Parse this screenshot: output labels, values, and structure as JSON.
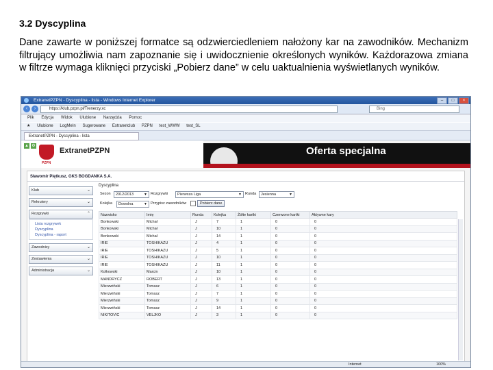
{
  "document": {
    "heading": "3.2 Dyscyplina",
    "paragraph": "Dane zawarte w poniższej formatce są odzwierciedleniem nałożony kar na zawodników. Mechanizm filtrujący umożliwia nam zapoznanie się i uwidocznienie określonych wyników. Każdorazowa zmiana w filtrze wymaga kliknięci przyciski „Pobierz dane” w celu uaktualnienia wyświetlanych wyników."
  },
  "browser": {
    "window_title": "ExtranetPZPN - Dyscyplina - lista - Windows Internet Explorer",
    "address": "https://klub.pzpn.pl/Trenerzy.xc",
    "search_placeholder": "Bing",
    "menu": [
      "Plik",
      "Edycja",
      "Widok",
      "Ulubione",
      "Narzędzia",
      "Pomoc"
    ],
    "favorites": [
      "Ulubione",
      "LogMeIn",
      "Sugerowane",
      "Extranetclub",
      "PZPN",
      "test_WWW",
      "test_SL"
    ],
    "tab": "ExtranetPZPN - Dyscyplina - lista",
    "status_zone": "Internet",
    "zoom": "100%"
  },
  "site": {
    "logo_text": "ExtranetPZPN",
    "logo_sub": "PZPN",
    "banner_text": "Oferta specjalna",
    "user_club": "Sławomir Piętkusz, GKS BOGDANKA S.A.",
    "sidebar": {
      "items": [
        {
          "label": "Klub"
        },
        {
          "label": "Rekrutery"
        },
        {
          "label": "Rozgrywki"
        },
        {
          "label": "Zawodnicy"
        },
        {
          "label": "Zestawienia"
        },
        {
          "label": "Administracja"
        }
      ],
      "subitems": [
        "Lista rozgrywek",
        "Dyscyplina",
        "Dyscyplina - raport"
      ]
    }
  },
  "main": {
    "section_title": "Dyscyplina",
    "filters": {
      "season_label": "Sezon",
      "season_value": "2012/2013",
      "games_label": "Rozgrywki",
      "games_value": "Pierwsza Liga",
      "round_label": "Runda",
      "round_value": "Jesienna",
      "queue_label": "Kolejka",
      "queue_value": "Dowolna",
      "active_players_label": "Przypisz zawodników",
      "fetch_button": "Pobierz dane"
    },
    "table": {
      "headers": [
        "Nazwisko",
        "Imię",
        "Runda",
        "Kolejka",
        "Żółte kartki",
        "Czerwone kartki",
        "Aktywne kary"
      ],
      "rows": [
        [
          "Bonkowski",
          "Michał",
          "J",
          "7",
          "1",
          "0",
          "0"
        ],
        [
          "Bonkowski",
          "Michał",
          "J",
          "10",
          "1",
          "0",
          "0"
        ],
        [
          "Bonkowski",
          "Michał",
          "J",
          "14",
          "1",
          "0",
          "0"
        ],
        [
          "IRIE",
          "TOSHIKAZU",
          "J",
          "4",
          "1",
          "0",
          "0"
        ],
        [
          "IRIE",
          "TOSHIKAZU",
          "J",
          "5",
          "1",
          "0",
          "0"
        ],
        [
          "IRIE",
          "TOSHIKAZU",
          "J",
          "10",
          "1",
          "0",
          "0"
        ],
        [
          "IRIE",
          "TOSHIKAZU",
          "J",
          "11",
          "1",
          "0",
          "0"
        ],
        [
          "Kolkowski",
          "Marcin",
          "J",
          "10",
          "1",
          "0",
          "0"
        ],
        [
          "MANDRYCZ",
          "ROBERT",
          "J",
          "13",
          "1",
          "0",
          "0"
        ],
        [
          "Mierzwiński",
          "Tomasz",
          "J",
          "6",
          "1",
          "0",
          "0"
        ],
        [
          "Mierzwiński",
          "Tomasz",
          "J",
          "7",
          "1",
          "0",
          "0"
        ],
        [
          "Mierzwiński",
          "Tomasz",
          "J",
          "9",
          "1",
          "0",
          "0"
        ],
        [
          "Mierzwiński",
          "Tomasz",
          "J",
          "14",
          "1",
          "0",
          "0"
        ],
        [
          "NIKITOVIC",
          "VELJKO",
          "J",
          "3",
          "1",
          "0",
          "0"
        ]
      ]
    }
  },
  "colors": {
    "titlebar": "#22559e",
    "brand_red": "#c21a26",
    "banner_bg": "#111111"
  }
}
